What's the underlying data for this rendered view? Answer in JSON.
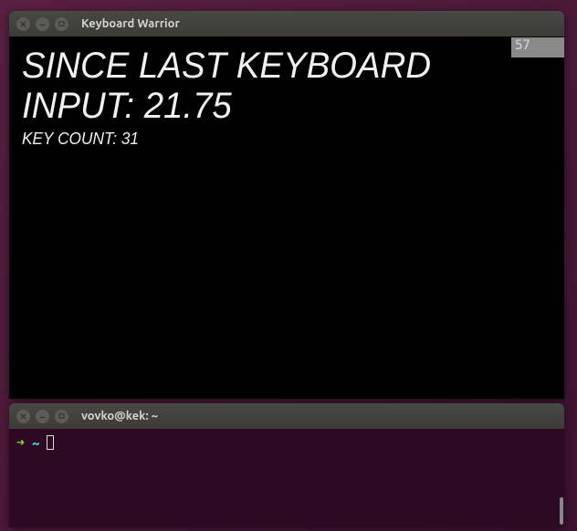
{
  "app_window": {
    "title": "Keyboard Warrior",
    "stat_main_label": "SINCE LAST KEYBOARD INPUT: ",
    "stat_main_value": "21.75",
    "stat_sub_label": "KEY COUNT: ",
    "stat_sub_value": "31",
    "fps": "57"
  },
  "terminal_window": {
    "title": "vovko@kek: ~",
    "prompt_arrow": "➜",
    "prompt_path": "~"
  }
}
